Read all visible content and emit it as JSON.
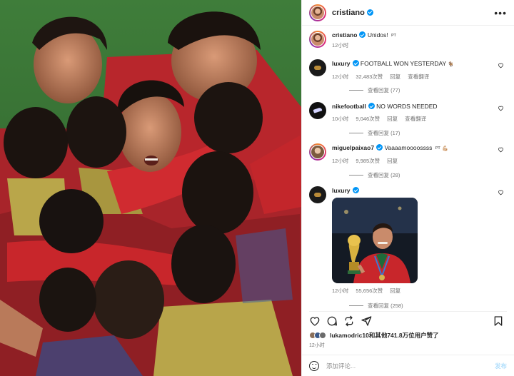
{
  "post": {
    "author": "cristiano",
    "caption_text": "Unidos!",
    "caption_tag": "PT",
    "caption_time": "12小时",
    "more_icon": "more-horizontal-icon"
  },
  "comments": [
    {
      "user": "luxury",
      "text": "FOOTBALL WON YESTERDAY",
      "emoji": "🐐",
      "time": "12小时",
      "likes": "32,483次赞",
      "reply_label": "回复",
      "translate_label": "查看翻译",
      "view_replies": "查看回复 (77)"
    },
    {
      "user": "nikefootball",
      "text": "NO WORDS NEEDED",
      "time": "10小时",
      "likes": "9,046次赞",
      "reply_label": "回复",
      "translate_label": "查看翻译",
      "view_replies": "查看回复 (17)"
    },
    {
      "user": "miguelpaixao7",
      "text": "Vaaaamoooossss",
      "tag": "PT",
      "emoji": "💪🏼",
      "time": "12小时",
      "likes": "9,985次赞",
      "reply_label": "回复",
      "view_replies": "查看回复 (28)"
    },
    {
      "user": "luxury",
      "time": "12小时",
      "likes": "55,656次赞",
      "reply_label": "回复",
      "view_replies": "查看回复 (258)"
    }
  ],
  "likes_line": {
    "user": "lukamodric10",
    "rest": "和其他741.8万位用户赞了"
  },
  "post_time": "12小时",
  "add_comment": {
    "placeholder": "添加评论...",
    "post_label": "发布"
  },
  "colors": {
    "verified": "#0095f6",
    "portugal_red": "#c8262b",
    "post_button_disabled": "#b2dffc"
  }
}
